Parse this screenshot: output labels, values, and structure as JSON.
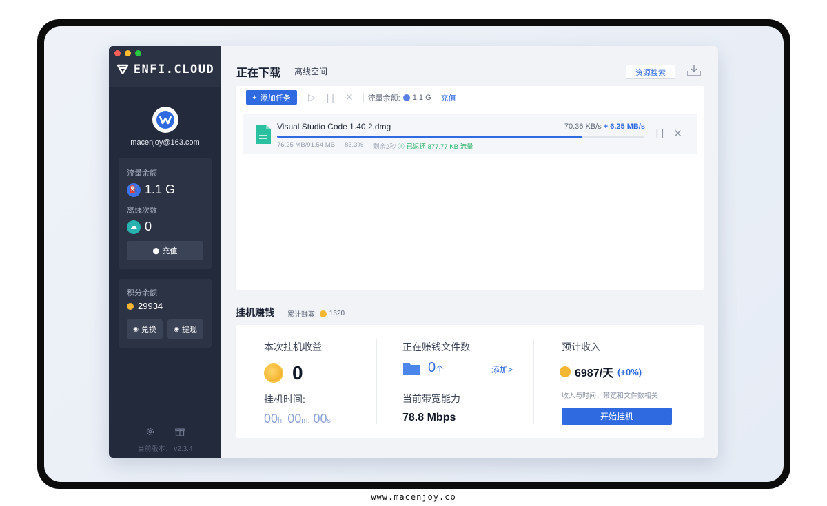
{
  "colors": {
    "accent": "#2f6ae0",
    "sidebar_bg": "#232a3b",
    "success": "#2eb46b",
    "coin": "#f2b632"
  },
  "sidebar": {
    "logo": "ENFI.CLOUD",
    "email": "macenjoy@163.com",
    "traffic_label": "流量余额",
    "traffic_value": "1.1 G",
    "offline_label": "离线次数",
    "offline_value": "0",
    "recharge_label": "充值",
    "points_label": "积分余额",
    "points_value": "29934",
    "exchange_label": "兑换",
    "withdraw_label": "提现",
    "version_label": "当前版本：",
    "version_value": "v2.3.4",
    "icons": [
      "settings-icon",
      "gift-icon"
    ]
  },
  "header": {
    "tab_active": "正在下载",
    "tab_offline": "离线空间",
    "search_button": "资源搜索",
    "download_icon": "download-icon"
  },
  "toolbar": {
    "add_task": "添加任务",
    "traffic_label": "流量余额:",
    "traffic_value": "1.1 G",
    "recharge": "充值"
  },
  "tasks": [
    {
      "name": "Visual Studio Code 1.40.2.dmg",
      "speed": "70.36 KB/s",
      "boost": "+ 6.25 MB/s",
      "progress": 0.833,
      "size": "76.25 MB/91.54 MB",
      "percent": "83.3%",
      "remaining": "剩余2秒",
      "returned": "已返还 877.77 KB 流量"
    }
  ],
  "earn": {
    "title": "挂机赚钱",
    "total_label": "累计赚取:",
    "total_value": "1620",
    "session_label": "本次挂机收益",
    "session_value": "0",
    "time_label": "挂机时间:",
    "time_h": "00",
    "time_h_unit": "h:",
    "time_m": "00",
    "time_m_unit": "m:",
    "time_s": "00",
    "time_s_unit": "s",
    "files_label": "正在赚钱文件数",
    "files_value": "0",
    "files_unit": "个",
    "add_link": "添加>",
    "bandwidth_label": "当前带宽能力",
    "bandwidth_value": "78.8 Mbps",
    "estimate_label": "预计收入",
    "estimate_value": "6987/天",
    "estimate_change": "(+0%)",
    "estimate_hint": "收入与时间、带宽和文件数相关",
    "start_button": "开始挂机"
  },
  "footer": "www.macenjoy.co"
}
